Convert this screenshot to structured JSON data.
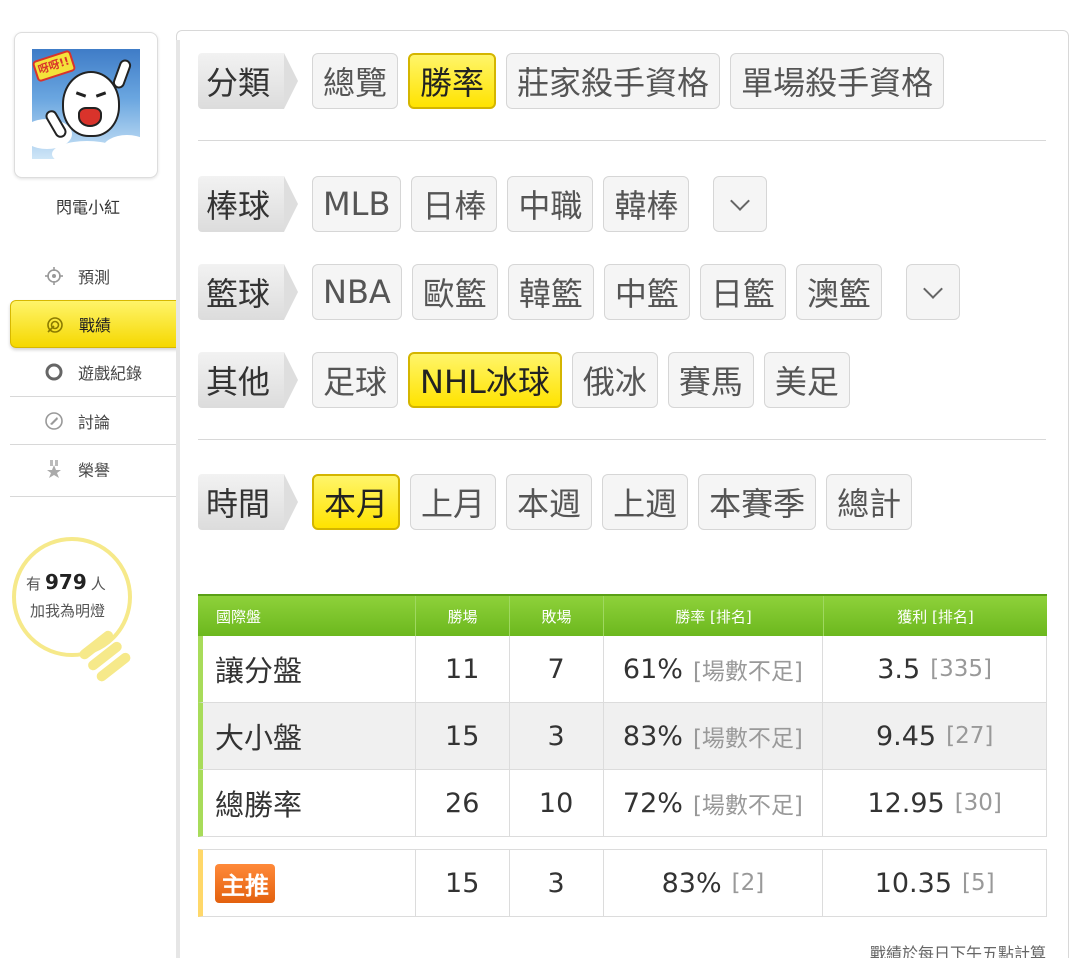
{
  "user": {
    "name": "閃電小紅",
    "avatar_text": "呀呀!!"
  },
  "sidebar": {
    "items": [
      {
        "label": "預測",
        "icon": "crosshair-icon"
      },
      {
        "label": "戰績",
        "icon": "target-icon",
        "active": true
      },
      {
        "label": "遊戲紀錄",
        "icon": "circle-icon"
      },
      {
        "label": "討論",
        "icon": "discussion-icon"
      },
      {
        "label": "榮譽",
        "icon": "medal-icon"
      }
    ]
  },
  "fans": {
    "prefix": "有",
    "count": "979",
    "suffix": "人",
    "line2": "加我為明燈"
  },
  "filters": {
    "category": {
      "tag": "分類",
      "options": [
        "總覽",
        "勝率",
        "莊家殺手資格",
        "單場殺手資格"
      ],
      "active": "勝率"
    },
    "baseball": {
      "tag": "棒球",
      "options": [
        "MLB",
        "日棒",
        "中職",
        "韓棒"
      ]
    },
    "basketball": {
      "tag": "籃球",
      "options": [
        "NBA",
        "歐籃",
        "韓籃",
        "中籃",
        "日籃",
        "澳籃"
      ]
    },
    "other": {
      "tag": "其他",
      "options": [
        "足球",
        "NHL冰球",
        "俄冰",
        "賽馬",
        "美足"
      ],
      "active": "NHL冰球"
    },
    "time": {
      "tag": "時間",
      "options": [
        "本月",
        "上月",
        "本週",
        "上週",
        "本賽季",
        "總計"
      ],
      "active": "本月"
    }
  },
  "table": {
    "headers": [
      "國際盤",
      "勝場",
      "敗場",
      "勝率 [排名]",
      "獲利 [排名]"
    ],
    "rows": [
      {
        "type": "讓分盤",
        "win": "11",
        "lose": "7",
        "rate": "61%",
        "rate_rank": "[場數不足]",
        "profit": "3.5",
        "profit_rank": "[335]"
      },
      {
        "type": "大小盤",
        "win": "15",
        "lose": "3",
        "rate": "83%",
        "rate_rank": "[場數不足]",
        "profit": "9.45",
        "profit_rank": "[27]"
      },
      {
        "type": "總勝率",
        "win": "26",
        "lose": "10",
        "rate": "72%",
        "rate_rank": "[場數不足]",
        "profit": "12.95",
        "profit_rank": "[30]"
      }
    ],
    "recommend": {
      "badge": "主推",
      "win": "15",
      "lose": "3",
      "rate": "83%",
      "rate_rank": "[2]",
      "profit": "10.35",
      "profit_rank": "[5]"
    }
  },
  "footnote": "戰績於每日下午五點計算"
}
